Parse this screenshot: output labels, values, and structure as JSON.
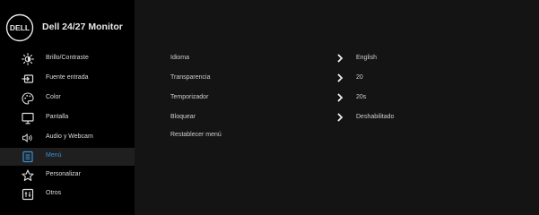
{
  "header": {
    "brand": "DELL",
    "model": "Dell 24/27 Monitor"
  },
  "menu": [
    {
      "label": "Brillo/Contraste",
      "icon": "brightness-icon",
      "active": false
    },
    {
      "label": "Fuente entrada",
      "icon": "input-source-icon",
      "active": false
    },
    {
      "label": "Color",
      "icon": "color-palette-icon",
      "active": false
    },
    {
      "label": "Pantalla",
      "icon": "display-icon",
      "active": false
    },
    {
      "label": "Audio y Webcam",
      "icon": "speaker-icon",
      "active": false
    },
    {
      "label": "Menú",
      "icon": "menu-icon",
      "active": true
    },
    {
      "label": "Personalizar",
      "icon": "star-icon",
      "active": false
    },
    {
      "label": "Otros",
      "icon": "others-icon",
      "active": false
    }
  ],
  "settings": [
    {
      "label": "Idioma",
      "value": "English",
      "has_submenu": true
    },
    {
      "label": "Transparencia",
      "value": "20",
      "has_submenu": true
    },
    {
      "label": "Temporizador",
      "value": "20s",
      "has_submenu": true
    },
    {
      "label": "Bloquear",
      "value": "Deshabilitado",
      "has_submenu": true
    },
    {
      "label": "Restablecer menú",
      "value": "",
      "has_submenu": false
    }
  ],
  "colors": {
    "accent": "#3a8fd6",
    "sidebar_bg": "#000000",
    "content_bg": "#141414",
    "active_row_bg": "#1f1f1f"
  }
}
